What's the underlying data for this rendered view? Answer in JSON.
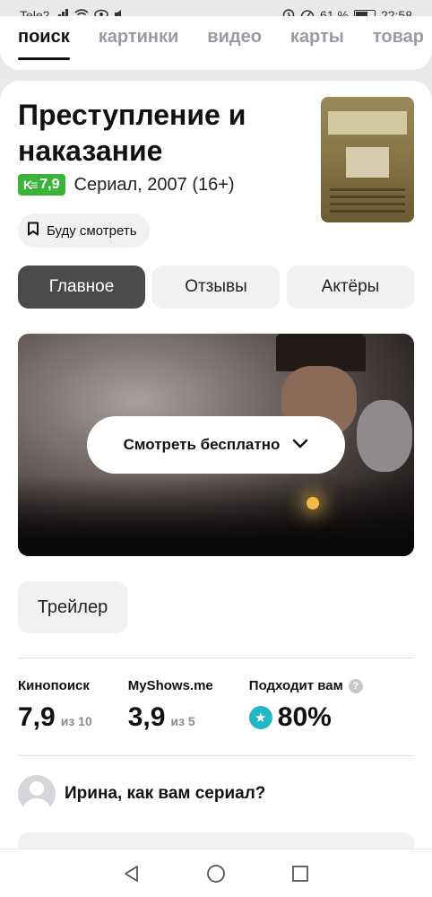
{
  "status_bar": {
    "carrier": "Tele2",
    "battery_percent": "61 %",
    "time": "22:58"
  },
  "search_tabs": [
    {
      "label": "поиск",
      "active": true
    },
    {
      "label": "картинки",
      "active": false
    },
    {
      "label": "видео",
      "active": false
    },
    {
      "label": "карты",
      "active": false
    },
    {
      "label": "товар",
      "active": false
    }
  ],
  "movie": {
    "title": "Преступление и наказание",
    "rating_badge": "7,9",
    "meta": "Сериал, 2007 (16+)"
  },
  "watch_later_label": "Буду смотреть",
  "segments": [
    {
      "label": "Главное",
      "active": true
    },
    {
      "label": "Отзывы",
      "active": false
    },
    {
      "label": "Актёры",
      "active": false
    }
  ],
  "banner": {
    "cta_label": "Смотреть бесплатно"
  },
  "trailer_label": "Трейлер",
  "ratings": [
    {
      "source": "Кинопоиск",
      "value": "7,9",
      "scale": "из 10"
    },
    {
      "source": "MyShows.me",
      "value": "3,9",
      "scale": "из 5"
    },
    {
      "source": "Подходит вам",
      "value": "80%",
      "help": "?"
    }
  ],
  "ask": {
    "text": "Ирина, как вам сериал?"
  },
  "colors": {
    "accent_green": "#3bb33b",
    "match_teal": "#1fb8c4",
    "active_segment": "#4a4a4a"
  }
}
